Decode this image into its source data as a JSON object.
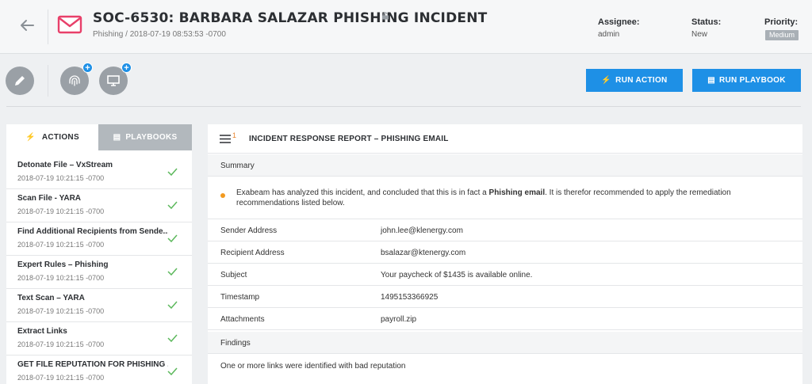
{
  "header": {
    "title": "SOC-6530: BARBARA SALAZAR PHISHING INCIDENT",
    "subtitle": "Phishing / 2018-07-19 08:53:53 -0700",
    "assignee_label": "Assignee:",
    "assignee_value": "admin",
    "status_label": "Status:",
    "status_value": "New",
    "priority_label": "Priority:",
    "priority_value": "Medium",
    "icons": [
      "back-arrow-icon",
      "mail-icon",
      "lock-icon"
    ]
  },
  "toolbar": {
    "tools": [
      "pencil-icon",
      "fingerprint-icon",
      "monitor-icon"
    ],
    "run_action_label": "RUN ACTION",
    "run_playbook_label": "RUN PLAYBOOK"
  },
  "left_panel": {
    "tab_actions": "ACTIONS",
    "tab_playbooks": "PLAYBOOKS",
    "items": [
      {
        "name": "Detonate File – VxStream",
        "time": "2018-07-19 10:21:15 -0700"
      },
      {
        "name": "Scan File - YARA",
        "time": "2018-07-19 10:21:15 -0700"
      },
      {
        "name": "Find Additional Recipients from Sende...",
        "time": "2018-07-19 10:21:15 -0700"
      },
      {
        "name": "Expert Rules – Phishing",
        "time": "2018-07-19 10:21:15 -0700"
      },
      {
        "name": "Text Scan – YARA",
        "time": "2018-07-19 10:21:15 -0700"
      },
      {
        "name": "Extract Links",
        "time": "2018-07-19 10:21:15 -0700"
      },
      {
        "name": "GET FILE REPUTATION FOR PHISHING ...",
        "time": "2018-07-19 10:21:15 -0700"
      }
    ]
  },
  "report": {
    "badge_count": "1",
    "title": "INCIDENT RESPONSE REPORT – PHISHING EMAIL",
    "summary_label": "Summary",
    "summary_text_1": "Exabeam has analyzed this incident, and concluded that this is in fact a ",
    "summary_bold": "Phishing email",
    "summary_text_2": ". It is therefor recommended to apply the remediation recommendations listed below.",
    "fields": [
      {
        "key": "Sender Address",
        "value": "john.lee@klenergy.com"
      },
      {
        "key": "Recipient Address",
        "value": "bsalazar@ktenergy.com"
      },
      {
        "key": "Subject",
        "value": "Your paycheck of $1435 is available online."
      },
      {
        "key": "Timestamp",
        "value": "1495153366925"
      },
      {
        "key": "Attachments",
        "value": "payroll.zip"
      }
    ],
    "findings_label": "Findings",
    "finding_text": "One or more links were identified with bad reputation"
  },
  "colors": {
    "accent": "#1e90e6",
    "mail_icon": "#e8406a",
    "check": "#5cb85c",
    "warning_dot": "#f29a1f"
  }
}
